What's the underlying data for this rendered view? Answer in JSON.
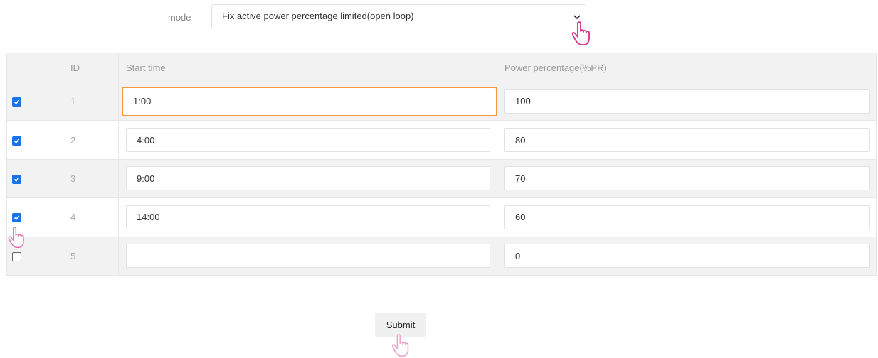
{
  "form": {
    "mode_label": "mode",
    "mode_value": "Fix active power percentage limited(open loop)"
  },
  "table": {
    "headers": {
      "select": "",
      "id": "ID",
      "start_time": "Start time",
      "power_percentage": "Power percentage(%PR)"
    },
    "rows": [
      {
        "checked": true,
        "id": "1",
        "start_time": "1:00",
        "power": "100"
      },
      {
        "checked": true,
        "id": "2",
        "start_time": "4:00",
        "power": "80"
      },
      {
        "checked": true,
        "id": "3",
        "start_time": "9:00",
        "power": "70"
      },
      {
        "checked": true,
        "id": "4",
        "start_time": "14:00",
        "power": "60"
      },
      {
        "checked": false,
        "id": "5",
        "start_time": "",
        "power": "0"
      }
    ]
  },
  "submit_label": "Submit",
  "colors": {
    "focus_border": "#f59a3c",
    "checkbox": "#1a73e8",
    "pointer_cursor": "#d6338a"
  },
  "icons": [
    "chevron-down-icon",
    "hand-pointer-icon"
  ]
}
